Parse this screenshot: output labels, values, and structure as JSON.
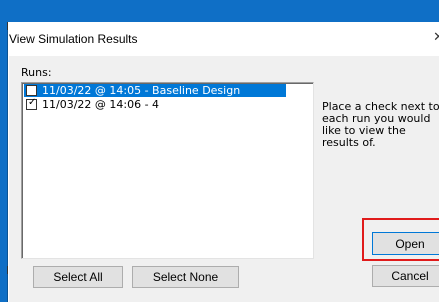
{
  "dialog": {
    "title": "View Simulation Results",
    "close_icon": "close-icon",
    "runs_label": "Runs:",
    "runs": [
      {
        "label": "11/03/22 @ 14:05 - Baseline Design",
        "checked": false,
        "selected": true
      },
      {
        "label": "11/03/22 @ 14:06 - 4",
        "checked": true,
        "selected": false
      }
    ],
    "hint": "Place a check next to each run you would like to view the results of.",
    "buttons": {
      "select_all": "Select All",
      "select_none": "Select None",
      "open": "Open",
      "cancel": "Cancel"
    }
  },
  "colors": {
    "desktop": "#0f6fc6",
    "selection": "#0078d7",
    "highlight": "#e01b1b"
  }
}
